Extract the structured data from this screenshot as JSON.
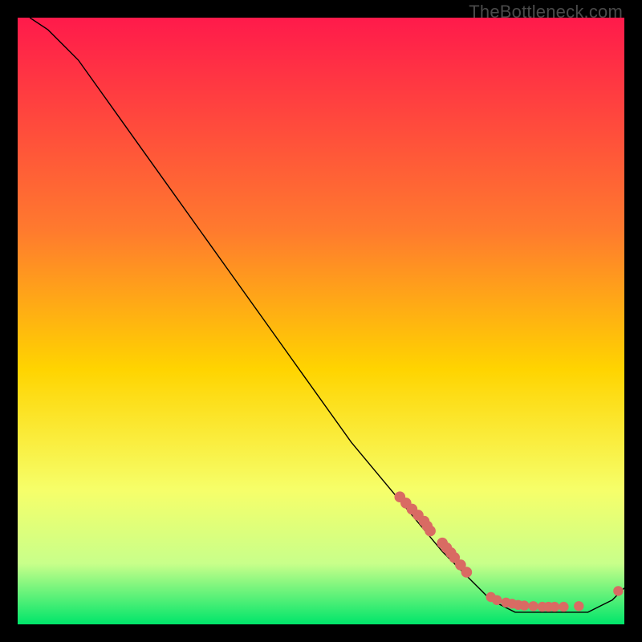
{
  "watermark": "TheBottleneck.com",
  "colors": {
    "gradient_top": "#ff1a4b",
    "gradient_upper_mid": "#ff7a2e",
    "gradient_mid": "#ffd400",
    "gradient_lower_mid": "#f6ff6a",
    "gradient_low": "#c8ff8a",
    "gradient_bottom": "#00e56a",
    "line": "#000000",
    "dot_fill": "#d96b63",
    "dot_stroke": "#b24f48"
  },
  "chart_data": {
    "type": "line",
    "title": "",
    "xlabel": "",
    "ylabel": "",
    "xlim": [
      0,
      100
    ],
    "ylim": [
      0,
      100
    ],
    "series": [
      {
        "name": "curve",
        "x": [
          2,
          5,
          8,
          10,
          15,
          20,
          25,
          30,
          35,
          40,
          45,
          50,
          55,
          60,
          65,
          70,
          72,
          74,
          76,
          78,
          80,
          82,
          84,
          86,
          88,
          90,
          92,
          94,
          96,
          98,
          100
        ],
        "y": [
          100,
          98,
          95,
          93,
          86,
          79,
          72,
          65,
          58,
          51,
          44,
          37,
          30,
          24,
          18,
          12,
          10,
          8,
          6,
          4,
          3,
          2,
          2,
          2,
          2,
          2,
          2,
          2,
          3,
          4,
          6
        ]
      }
    ],
    "clusters": [
      {
        "name": "upper-dot-band",
        "points": [
          [
            63,
            21
          ],
          [
            64,
            20
          ],
          [
            65,
            19
          ],
          [
            66,
            18
          ],
          [
            67,
            17
          ],
          [
            67.5,
            16.2
          ],
          [
            68,
            15.4
          ],
          [
            70,
            13.4
          ],
          [
            70.7,
            12.6
          ],
          [
            71.4,
            11.8
          ],
          [
            72,
            11
          ],
          [
            73,
            9.8
          ],
          [
            74,
            8.6
          ]
        ],
        "radius": 6.8
      },
      {
        "name": "valley-dot-band",
        "points": [
          [
            78,
            4.5
          ],
          [
            79,
            4.0
          ],
          [
            80.5,
            3.6
          ],
          [
            81.5,
            3.4
          ],
          [
            82.5,
            3.2
          ],
          [
            83.5,
            3.1
          ],
          [
            85,
            3.0
          ],
          [
            86.5,
            2.9
          ],
          [
            87.5,
            2.9
          ],
          [
            88.5,
            2.9
          ],
          [
            90,
            2.9
          ],
          [
            92.5,
            3.0
          ]
        ],
        "radius": 6.2
      },
      {
        "name": "tail-dot",
        "points": [
          [
            99,
            5.5
          ]
        ],
        "radius": 6.2
      }
    ]
  }
}
